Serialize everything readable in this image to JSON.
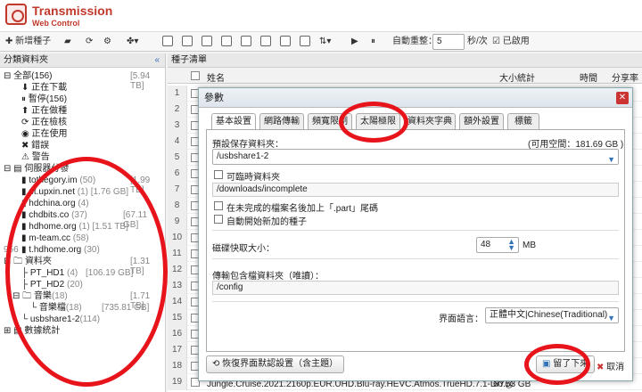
{
  "app": {
    "title": "Transmission",
    "subtitle": "Web Control"
  },
  "toolbar": {
    "add_torrent": "新增種子",
    "auto_reload_label": "自動重整：",
    "auto_reload_value": "5",
    "auto_reload_unit": "秒/次",
    "enabled_label": "已啟用"
  },
  "left_panel": {
    "title": "分類資料夾",
    "all": {
      "label": "全部(156)",
      "size": "[5.94 TB]"
    },
    "statuses": [
      {
        "label": "正在下載"
      },
      {
        "label": "暫停(156)"
      },
      {
        "label": "正在做種"
      },
      {
        "label": "正在檢核"
      },
      {
        "label": "正在使用"
      },
      {
        "label": "錯誤"
      },
      {
        "label": "警告"
      }
    ],
    "servers_label": "伺服器分發",
    "servers": [
      {
        "label": "tothegory.im",
        "count": "(50)",
        "size": "[1.99 TB]"
      },
      {
        "label": "pt.upxin.net",
        "count": "(1)",
        "size": "[1.76 GB]"
      },
      {
        "label": "hdchina.org",
        "count": "(4)",
        "size": ""
      },
      {
        "label": "chdbits.co",
        "count": "(37)",
        "size": "[67.11 GB]"
      },
      {
        "label": "hdhome.org",
        "count": "(1)",
        "size": "[1.51 TB]"
      },
      {
        "label": "m-team.cc",
        "count": "(58)",
        "size": ""
      },
      {
        "label": "t.hdhome.org",
        "count": "(30)",
        "size": ""
      }
    ],
    "folders_label": "資料夾",
    "folders_size": "[1.31 TB]",
    "folders": [
      {
        "label": "PT_HD1",
        "count": "(4)",
        "size": "[106.19 GB]"
      },
      {
        "label": "PT_HD2",
        "count": "(20)",
        "size": ""
      },
      {
        "label": "音樂",
        "count": "(18)",
        "size": "[1.71 TB]"
      },
      {
        "label": "音樂檔",
        "count": "(18)",
        "size": "[735.81 GB]"
      },
      {
        "label": "usbshare1-2",
        "count": "(114)",
        "size": ""
      }
    ],
    "stats_label": "數據統計",
    "stray_count": "956"
  },
  "grid": {
    "title": "種子清單",
    "columns": [
      "姓名",
      "大小統計",
      "時間",
      "分享率"
    ],
    "row_numbers": [
      "1",
      "2",
      "3",
      "4",
      "5",
      "6",
      "7",
      "8",
      "9",
      "10",
      "11",
      "12",
      "13",
      "14",
      "15",
      "16",
      "17",
      "18",
      "19"
    ],
    "last_row": {
      "name": "Jungle.Cruise.2021.2160p.EUR.UHD.Blu-ray.HEVC.Atmos.TrueHD.7.1-DiY@",
      "size": "60.53 GB"
    }
  },
  "dialog": {
    "title": "參數",
    "tabs": [
      "基本設置",
      "網路傳輸",
      "頻寬限制",
      "太陽極限",
      "資料夾字典",
      "額外設置",
      "標籤"
    ],
    "download_dir_label": "預設保存資料夾：",
    "free_space": "(可用空間：181.69 GB )",
    "download_dir_value": "/usbshare1-2",
    "temp_dir_label": "可臨時資料夾",
    "temp_dir_value": "/downloads/incomplete",
    "part_ext_label": "在未完成的檔案名後加上「.part」尾碼",
    "auto_start_label": "自動開始新加的種子",
    "cache_label": "磁碟快取大小：",
    "cache_value": "48",
    "cache_unit": "MB",
    "config_label": "傳輸包含檔資料夾（唯讀）：",
    "config_value": "/config",
    "lang_label": "界面語言：",
    "lang_value": "正體中文|Chinese(Traditional)",
    "restore_button": "恢復界面默認設置（含主題）",
    "save_button": "留了下來",
    "cancel_button": "取消"
  },
  "colors": {
    "brand": "#c0392b",
    "annotation": "#e8141b",
    "accent": "#3373b8"
  }
}
